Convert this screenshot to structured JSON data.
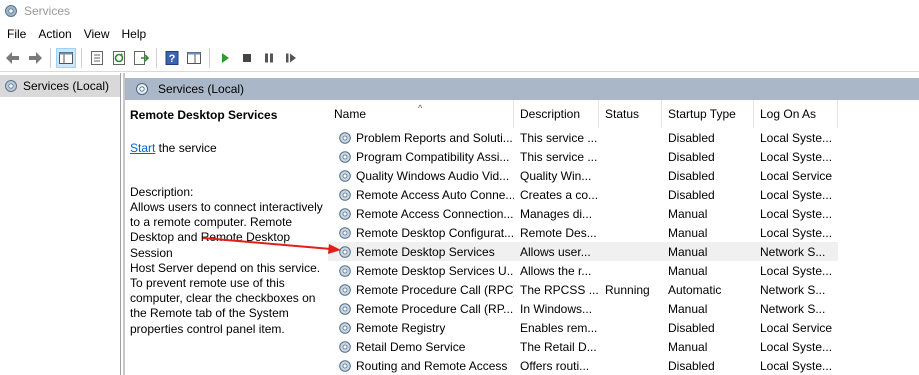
{
  "window": {
    "title": "Services",
    "icon": "gear-icon"
  },
  "menu": [
    "File",
    "Action",
    "View",
    "Help"
  ],
  "toolbar": {
    "buttons": [
      "back-arrow-icon",
      "forward-arrow-icon",
      "show-tree-icon",
      "properties-icon",
      "refresh-icon",
      "export-list-icon",
      "help-icon",
      "console-view-icon",
      "play-icon",
      "stop-icon",
      "pause-icon",
      "restart-icon"
    ]
  },
  "tree": {
    "root_label": "Services (Local)"
  },
  "pane": {
    "header": "Services (Local)"
  },
  "details": {
    "service_title": "Remote Desktop Services",
    "start_link": "Start",
    "start_suffix": " the service",
    "description_label": "Description:",
    "description_lines": [
      "Allows users to connect interactively",
      "to a remote computer. Remote",
      "Desktop and Remote Desktop Session",
      "Host Server depend on this service.",
      "To prevent remote use of this",
      "computer, clear the checkboxes on",
      "the Remote tab of the System",
      "properties control panel item."
    ]
  },
  "columns": {
    "name": "Name",
    "description": "Description",
    "status": "Status",
    "startup": "Startup Type",
    "logon": "Log On As"
  },
  "rows": [
    {
      "name": "Problem Reports and Soluti...",
      "description": "This service ...",
      "status": "",
      "startup": "Disabled",
      "logon": "Local Syste..."
    },
    {
      "name": "Program Compatibility Assi...",
      "description": "This service ...",
      "status": "",
      "startup": "Disabled",
      "logon": "Local Syste..."
    },
    {
      "name": "Quality Windows Audio Vid...",
      "description": "Quality Win...",
      "status": "",
      "startup": "Disabled",
      "logon": "Local Service"
    },
    {
      "name": "Remote Access Auto Conne...",
      "description": "Creates a co...",
      "status": "",
      "startup": "Disabled",
      "logon": "Local Syste..."
    },
    {
      "name": "Remote Access Connection...",
      "description": "Manages di...",
      "status": "",
      "startup": "Manual",
      "logon": "Local Syste..."
    },
    {
      "name": "Remote Desktop Configurat...",
      "description": "Remote Des...",
      "status": "",
      "startup": "Manual",
      "logon": "Local Syste..."
    },
    {
      "name": "Remote Desktop Services",
      "description": "Allows user...",
      "status": "",
      "startup": "Manual",
      "logon": "Network S..."
    },
    {
      "name": "Remote Desktop Services U...",
      "description": "Allows the r...",
      "status": "",
      "startup": "Manual",
      "logon": "Local Syste..."
    },
    {
      "name": "Remote Procedure Call (RPC)",
      "description": "The RPCSS ...",
      "status": "Running",
      "startup": "Automatic",
      "logon": "Network S..."
    },
    {
      "name": "Remote Procedure Call (RP...",
      "description": "In Windows...",
      "status": "",
      "startup": "Manual",
      "logon": "Network S..."
    },
    {
      "name": "Remote Registry",
      "description": "Enables rem...",
      "status": "",
      "startup": "Disabled",
      "logon": "Local Service"
    },
    {
      "name": "Retail Demo Service",
      "description": "The Retail D...",
      "status": "",
      "startup": "Manual",
      "logon": "Local Syste..."
    },
    {
      "name": "Routing and Remote Access",
      "description": "Offers routi...",
      "status": "",
      "startup": "Disabled",
      "logon": "Local Syste..."
    }
  ],
  "selected_row": 6,
  "colors": {
    "pane_header": "#a9b7c9",
    "arrow": "#e0201b",
    "link": "#0066cc"
  }
}
